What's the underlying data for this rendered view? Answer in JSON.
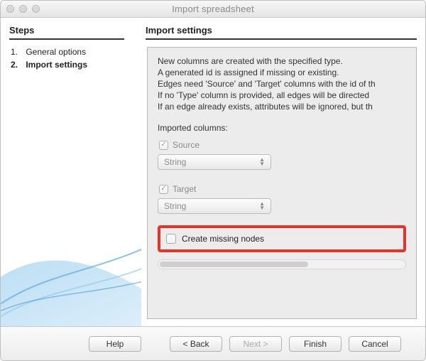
{
  "window": {
    "title": "Import spreadsheet"
  },
  "sidebar": {
    "heading": "Steps",
    "items": [
      {
        "num": "1.",
        "label": "General options",
        "current": false
      },
      {
        "num": "2.",
        "label": "Import settings",
        "current": true
      }
    ]
  },
  "main": {
    "heading": "Import settings",
    "description": [
      "New columns are created with the specified type.",
      "A generated id is assigned if missing or existing.",
      "Edges need 'Source' and 'Target' columns with the id of th",
      "If no 'Type' column is provided, all edges will be directed",
      "If an edge already exists, attributes will be ignored, but th"
    ],
    "imported_label": "Imported columns:",
    "columns": [
      {
        "name": "Source",
        "checked": true,
        "type": "String"
      },
      {
        "name": "Target",
        "checked": true,
        "type": "String"
      }
    ],
    "create_missing_nodes": {
      "label": "Create missing nodes",
      "checked": false
    }
  },
  "footer": {
    "help": "Help",
    "back": "< Back",
    "next": "Next >",
    "finish": "Finish",
    "cancel": "Cancel",
    "next_disabled": true
  }
}
